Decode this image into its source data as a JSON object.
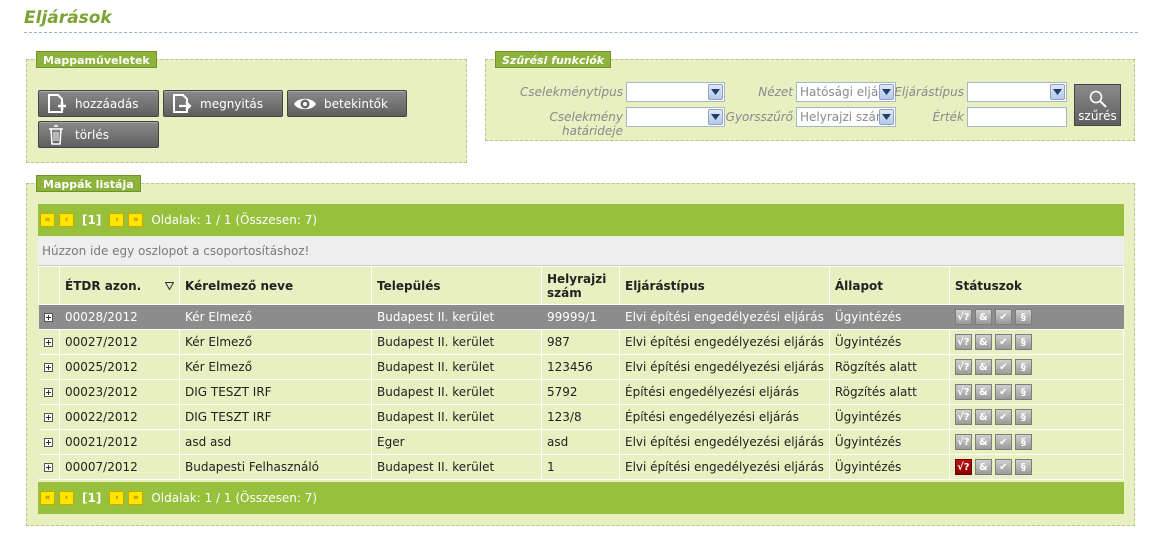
{
  "page": {
    "title": "Eljárások"
  },
  "folder_ops": {
    "legend": "Mappaműveletek",
    "buttons": {
      "add": "hozzáadás",
      "open": "megnyitás",
      "viewers": "betekintők",
      "delete": "törlés"
    }
  },
  "filters": {
    "legend": "Szűrési funkciók",
    "labels": {
      "event_type": "Cselekménytípus",
      "event_deadline": "Cselekmény határideje",
      "view": "Nézet",
      "quick_filter": "Gyorsszűrő",
      "procedure_type": "Eljárástípus",
      "value": "Érték"
    },
    "values": {
      "event_type": "",
      "event_deadline": "",
      "view": "Hatósági eljárá",
      "quick_filter": "Helyrajzi szám",
      "procedure_type": "",
      "value": ""
    },
    "search_label": "szűrés"
  },
  "folders": {
    "legend": "Mappák listája",
    "pager": {
      "current": "[1]",
      "info": "Oldalak: 1 / 1 (Összesen: 7)"
    },
    "group_hint": "Húzzon ide egy oszlopot a csoportosításhoz!",
    "columns": {
      "etdr": "ÉTDR azon.",
      "applicant": "Kérelmező neve",
      "settlement": "Település",
      "lot_line1": "Helyrajzi",
      "lot_line2": "szám",
      "proc_type": "Eljárástípus",
      "state": "Állapot",
      "statuses": "Státuszok"
    },
    "rows": [
      {
        "etdr": "00028/2012",
        "applicant": "Kér Elmező",
        "settlement": "Budapest II. kerület",
        "lot": "99999/1",
        "proc_type": "Elvi építési engedélyezési eljárás",
        "state": "Ügyintézés"
      },
      {
        "etdr": "00027/2012",
        "applicant": "Kér Elmező",
        "settlement": "Budapest II. kerület",
        "lot": "987",
        "proc_type": "Elvi építési engedélyezési eljárás",
        "state": "Ügyintézés"
      },
      {
        "etdr": "00025/2012",
        "applicant": "Kér Elmező",
        "settlement": "Budapest II. kerület",
        "lot": "123456",
        "proc_type": "Elvi építési engedélyezési eljárás",
        "state": "Rögzítés alatt"
      },
      {
        "etdr": "00023/2012",
        "applicant": "DIG TESZT IRF",
        "settlement": "Budapest II. kerület",
        "lot": "5792",
        "proc_type": "Építési engedélyezési eljárás",
        "state": "Rögzítés alatt"
      },
      {
        "etdr": "00022/2012",
        "applicant": "DIG TESZT IRF",
        "settlement": "Budapest II. kerület",
        "lot": "123/8",
        "proc_type": "Építési engedélyezési eljárás",
        "state": "Ügyintézés"
      },
      {
        "etdr": "00021/2012",
        "applicant": "asd asd",
        "settlement": "Eger",
        "lot": "asd",
        "proc_type": "Elvi építési engedélyezési eljárás",
        "state": "Ügyintézés"
      },
      {
        "etdr": "00007/2012",
        "applicant": "Budapesti Felhasználó",
        "settlement": "Budapest II. kerület",
        "lot": "1",
        "proc_type": "Elvi építési engedélyezési eljárás",
        "state": "Ügyintézés"
      }
    ],
    "status_icons": [
      "√?",
      "&",
      "✔",
      "§"
    ]
  },
  "colors": {
    "accent": "#97c03d",
    "panel": "#e8efc0",
    "title": "#7aa332",
    "alert": "#a00000"
  }
}
